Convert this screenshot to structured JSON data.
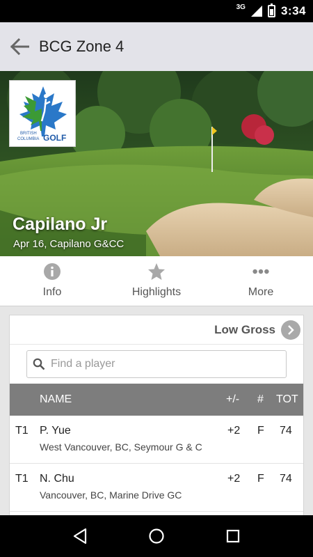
{
  "status_bar": {
    "network": "3G",
    "time": "3:34"
  },
  "app_bar": {
    "title": "BCG Zone 4"
  },
  "hero": {
    "logo_text_1": "BRITISH",
    "logo_text_2": "COLUMBIA",
    "logo_text_3": "GOLF",
    "event_name": "Capilano Jr",
    "event_sub": "Apr 16, Capilano G&CC"
  },
  "tabs": [
    {
      "label": "Info",
      "icon": "info-icon"
    },
    {
      "label": "Highlights",
      "icon": "star-icon"
    },
    {
      "label": "More",
      "icon": "more-dots-icon"
    }
  ],
  "leaderboard": {
    "format_label": "Low Gross",
    "search_placeholder": "Find a player",
    "columns": {
      "name": "NAME",
      "diff": "+/-",
      "thru": "#",
      "total": "TOT"
    },
    "rows": [
      {
        "pos": "T1",
        "name": "P. Yue",
        "club": "West Vancouver, BC, Seymour G & C",
        "diff": "+2",
        "thru": "F",
        "total": "74"
      },
      {
        "pos": "T1",
        "name": "N. Chu",
        "club": "Vancouver, BC, Marine Drive GC",
        "diff": "+2",
        "thru": "F",
        "total": "74"
      }
    ]
  },
  "colors": {
    "app_bar": "#e3e3e9",
    "header_row": "#7d7d7d",
    "logo_green": "#3c9a35",
    "logo_blue": "#1f5aa8"
  }
}
